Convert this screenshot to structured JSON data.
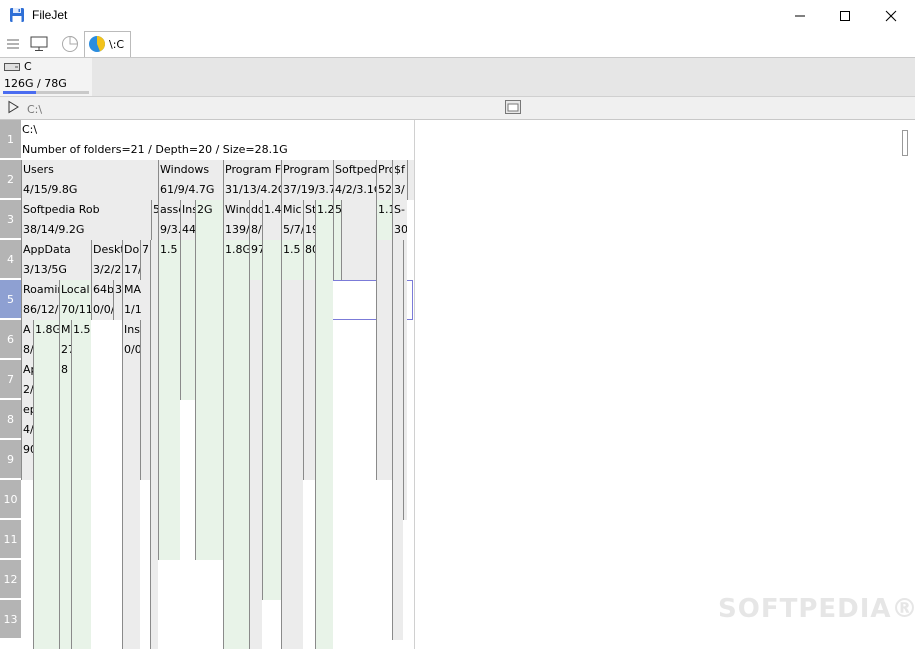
{
  "window": {
    "title": "FileJet"
  },
  "toolbar": {
    "tab_label": "\\:C"
  },
  "drive": {
    "name": "C",
    "size": "126G / 78G",
    "used_fraction": 0.38
  },
  "pathbar": {
    "path_value": "C:\\"
  },
  "rows": [
    "1",
    "2",
    "3",
    "4",
    "5",
    "6",
    "7",
    "8",
    "9",
    "10",
    "11",
    "12",
    "13"
  ],
  "root": {
    "name": "C:\\",
    "info": "Number of folders=21 / Depth=20 / Size=28.1G"
  },
  "r2": {
    "users_name": "Users",
    "users_info": "4/15/9.8G",
    "windows_name": "Windows",
    "windows_info": "61/9/4.7G",
    "pf_name": "Program F",
    "pf_info": "31/13/4.2G",
    "program_name": "Program",
    "program_info": "37/19/3.7",
    "softped_name": "Softped",
    "softped_info": "4/2/3.1G",
    "pro_name": "Pro",
    "pro_info": "52/",
    "sfa_name": "$f",
    "sfa_info": "3/"
  },
  "r3": {
    "rob_name": "Softpedia Rob",
    "rob_info": "38/14/9.2G",
    "five_a": "5",
    "asse_name": "asse",
    "asse_info": "9/3.",
    "ins_name": "Ins",
    "ins_info": "44/",
    "twog": "2G",
    "winds_name": "Wind",
    "winds_info": "139/",
    "do_name": "do",
    "do_info": "8/",
    "v14": "1.4",
    "mic_name": "Mic",
    "mic_info": "5/7/",
    "st_name": "St",
    "st_info": "19",
    "v12": "1.2",
    "five_b": "5",
    "v11": "1.1",
    "s_name": "S-",
    "s_info": "30"
  },
  "r4": {
    "appdata_name": "AppData",
    "appdata_info": "3/13/5G",
    "desk_name": "Deskt",
    "desk_info": "3/2/2",
    "do_name": "Do",
    "do_info": "17/",
    "seven": "7",
    "v15a": "1.5",
    "v18": "1.8G",
    "v97": "97",
    "v15b": "1.5",
    "v80": "80"
  },
  "r5": {
    "roam_name": "Roamin",
    "roam_info": "86/12/",
    "local_name": "Local",
    "local_info": "70/11",
    "b64_name": "64b",
    "b64_info": "0/0/",
    "three": "3",
    "ma_name": "MA",
    "ma_info": "1/1"
  },
  "r6": {
    "a_name": "A",
    "a_info": "8/",
    "v18": "1.8G",
    "m_name": "M",
    "m_info": "27",
    "v15": "1.5",
    "ins_name": "Ins",
    "ins_info": "0/0"
  },
  "r7": {
    "ap_name": "Ap",
    "ap_info": "2/",
    "v8": "8"
  },
  "r8": {
    "ep_name": "ep",
    "ep_info": "4/"
  },
  "r9": {
    "v90": "90"
  },
  "watermark": "SOFTPEDIA®",
  "colors": {
    "cell_fill": "#e8f3e8",
    "cell_fill_alt": "#ececec",
    "row_header": "#b4b4b4",
    "row_header_selected": "#8ea0d2",
    "selection": "#7b7bd8",
    "drive_bar": "#4a6cf0"
  }
}
